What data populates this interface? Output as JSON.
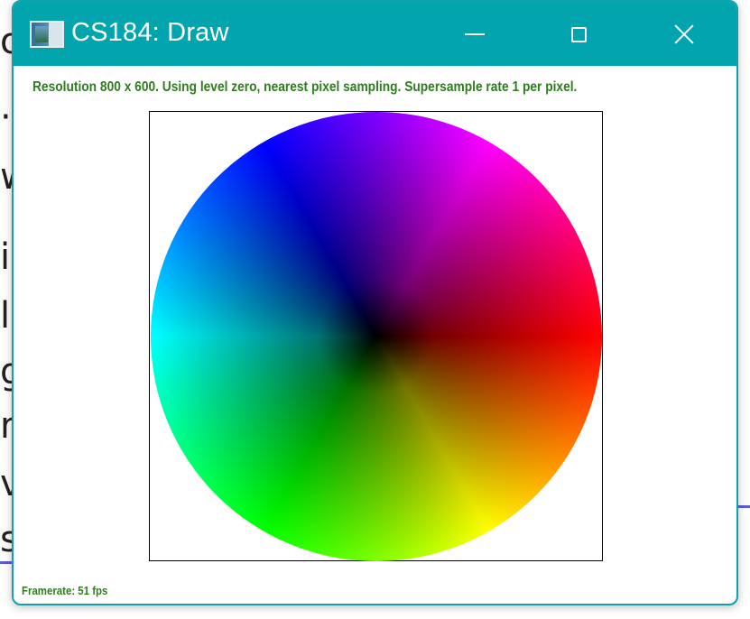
{
  "window": {
    "title": "CS184: Draw",
    "app_icon": "app-window-icon",
    "controls": {
      "minimize_icon": "minimize-icon",
      "maximize_icon": "maximize-icon",
      "close_icon": "close-icon"
    },
    "titlebar_color": "#02a5ae"
  },
  "status": {
    "text": "Resolution 800 x 600. Using level zero, nearest pixel sampling. Supersample rate 1 per pixel.",
    "color": "#2e7d1f"
  },
  "canvas": {
    "content": "hsv-color-wheel"
  },
  "footer": {
    "framerate": "Framerate: 51 fps"
  },
  "background_document": {
    "fragments": [
      "o",
      "·",
      "w",
      "ib",
      "le",
      "g",
      "r",
      "v",
      "se"
    ]
  }
}
